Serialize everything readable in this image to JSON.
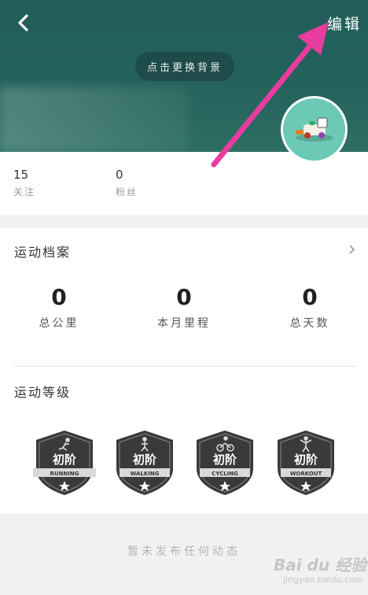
{
  "header": {
    "edit_label": "编辑",
    "change_bg_label": "点击更换背景"
  },
  "stats": [
    {
      "value": "15",
      "label": "关注"
    },
    {
      "value": "0",
      "label": "粉丝"
    }
  ],
  "profile": {
    "title": "运动档案",
    "metrics": [
      {
        "value": "0",
        "label": "总公里"
      },
      {
        "value": "0",
        "label": "本月里程"
      },
      {
        "value": "0",
        "label": "总天数"
      }
    ]
  },
  "levels": {
    "title": "运动等级",
    "badges": [
      {
        "level": "初阶",
        "sport": "RUNNING",
        "icon": "runner-icon"
      },
      {
        "level": "初阶",
        "sport": "WALKING",
        "icon": "walker-icon"
      },
      {
        "level": "初阶",
        "sport": "CYCLING",
        "icon": "cyclist-icon"
      },
      {
        "level": "初阶",
        "sport": "WORKOUT",
        "icon": "workout-icon"
      }
    ]
  },
  "feed": {
    "empty_text": "暂未发布任何动态"
  },
  "watermark": {
    "brand": "Bai du 经验",
    "url": "jingyan.baidu.com"
  },
  "colors": {
    "header_bg": "#215e5b",
    "avatar_bg": "#6cc9b6",
    "arrow": "#e83c9e",
    "badge_fill": "#3a3a3a"
  }
}
